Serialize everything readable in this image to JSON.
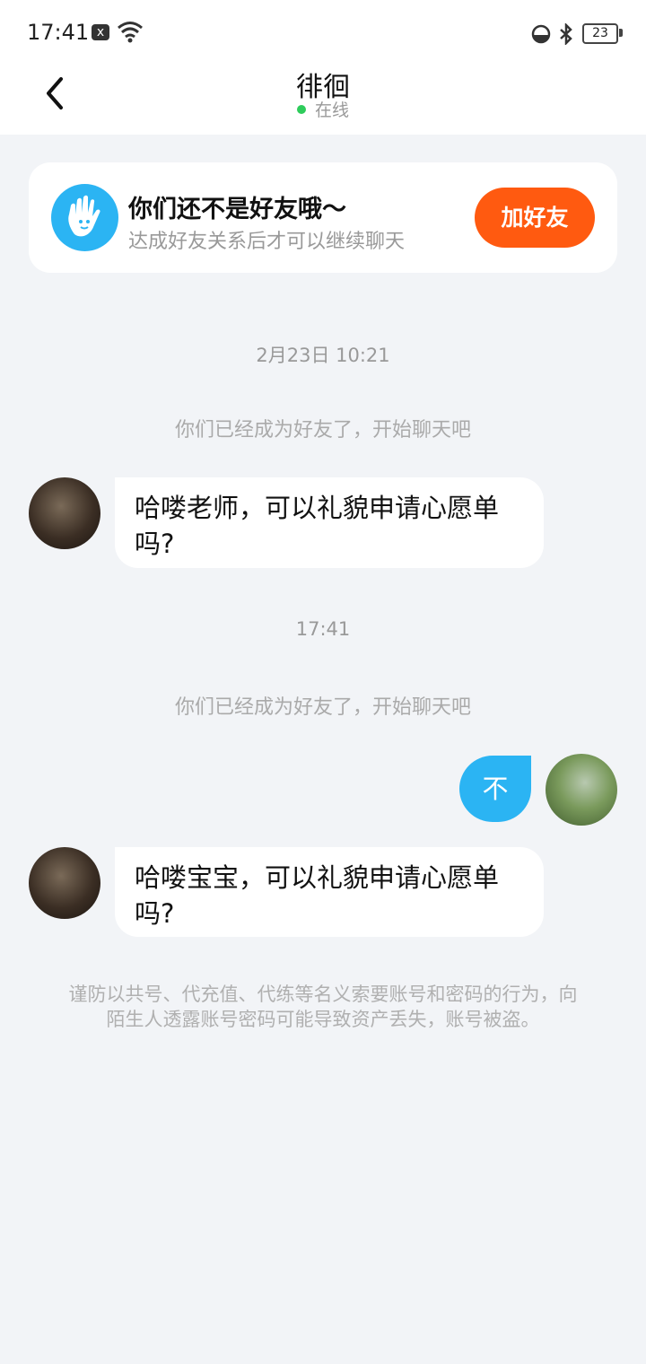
{
  "status_bar": {
    "time": "17:41",
    "notification_badge": "x",
    "battery": "23"
  },
  "header": {
    "contact_name": "徘徊",
    "presence": "在线"
  },
  "friend_card": {
    "title": "你们还不是好友哦～",
    "subtitle": "达成好友关系后才可以继续聊天",
    "add_button": "加好友"
  },
  "messages": [
    {
      "type": "timestamp",
      "text": "2月23日 10:21"
    },
    {
      "type": "system",
      "text": "你们已经成为好友了，开始聊天吧"
    },
    {
      "type": "incoming",
      "text": "哈喽老师，可以礼貌申请心愿单吗?"
    },
    {
      "type": "timestamp",
      "text": "17:41"
    },
    {
      "type": "system",
      "text": "你们已经成为好友了，开始聊天吧"
    },
    {
      "type": "outgoing",
      "text": "不"
    },
    {
      "type": "incoming",
      "text": "哈喽宝宝，可以礼貌申请心愿单吗?"
    }
  ],
  "warning": "谨防以共号、代充值、代练等名义索要账号和密码的行为，向陌生人透露账号密码可能导致资产丢失，账号被盗。",
  "colors": {
    "accent_blue": "#2bb4f3",
    "add_button_orange": "#ff5a10",
    "online_green": "#2ecc5b",
    "background": "#f2f4f7"
  },
  "icons": {
    "back": "chevron-left-icon",
    "card": "hand-icon",
    "status_wifi": "wifi-icon",
    "status_bluetooth": "bluetooth-icon"
  }
}
